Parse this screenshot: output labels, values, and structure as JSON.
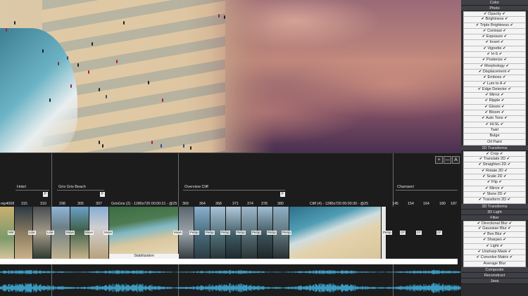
{
  "panel": {
    "header_color": "Color",
    "header_photo": "Photo",
    "photo_items": [
      "✔ Opacity ✔",
      "✔ Brightness ✔",
      "✔ Triple Brightness ✔",
      "✔ Contrast ✔",
      "✔ Exposure ✔",
      "✔ Invert ✔",
      "✔ Vignette ✔",
      "✔ H-S ✔",
      "✔ Posterize ✔",
      "✔ Morphology ✔",
      "✔ Displacement ✔",
      "✔ Emboss ✔",
      "✔ Lum to A ✔",
      "✔ Edge Detector ✔",
      "✔ Mirror ✔",
      "✔ Ripple ✔",
      "✔ Gloom ✔",
      "✔ Bloom ✔",
      "✔ Auto Tone ✔",
      "✔ HLSL ✔",
      "Twirl",
      "Bulge",
      "Oil Paint"
    ],
    "header_2d": "2D Transforms",
    "t2d_items": [
      "✔ Crop ✔",
      "✔ Translate 2D ✔",
      "✔ Straighten 2D ✔",
      "✔ Rotate 2D ✔",
      "✔ Scale 2D ✔",
      "✔ Flip ✔",
      "✔ Mirror ✔",
      "✔ Skew 2D ✔",
      "✔ Transform 2D ✔"
    ],
    "header_3dt": "3D Transforms",
    "header_3dl": "3D Light",
    "header_filter": "Filter",
    "filter_items": [
      "✔ Directional Blur ✔",
      "✔ Gaussian Blur ✔",
      "✔ Box Blur ✔",
      "✔ Sharpen ✔",
      "✔ Light ✔",
      "✔ Unsharp Mask ✔",
      "✔ Convolve Matrix ✔",
      "Average Blur"
    ],
    "header_composite": "Composite",
    "header_reconstruct": "Reconstruct",
    "header_java": "Java"
  },
  "timeline": {
    "buttons": [
      "+",
      "—",
      "A"
    ],
    "tracks": [
      {
        "label": "Hotel",
        "marker": "F"
      },
      {
        "label": "Gris Gris Beach",
        "marker": "F"
      },
      {
        "label": "Overview Cliff",
        "marker": "F"
      },
      {
        "label": "Chamarel",
        "marker": ""
      }
    ],
    "numbers": [
      "mp4068",
      "315",
      "310",
      "298",
      "305",
      "307",
      "GrisGris (2) - 1280x720 00:00:21 - @25",
      "369",
      "364",
      "368",
      "371",
      "374",
      "378",
      "380",
      "Cliff (4) - 1280x720 00:00:30 - @25",
      "145",
      "154",
      "164",
      "180",
      "187"
    ],
    "thumb_labels": [
      "Mirr",
      "Line",
      "Line",
      "Move",
      "Move",
      "Move",
      "Move",
      "Persp",
      "Persp",
      "Persp",
      "Persp",
      "Persp",
      "Persp",
      "Persp",
      "Persp",
      "Persp",
      "Persp"
    ],
    "stabilization": "Stabilization",
    "cut_labels": [
      "Persp",
      "CF",
      "CF",
      "CF"
    ]
  },
  "colors": {
    "audio_wave": "#3b9ac0",
    "panel_bg": "#2d2d30",
    "panel_item_bg": "#f4f4f4"
  }
}
